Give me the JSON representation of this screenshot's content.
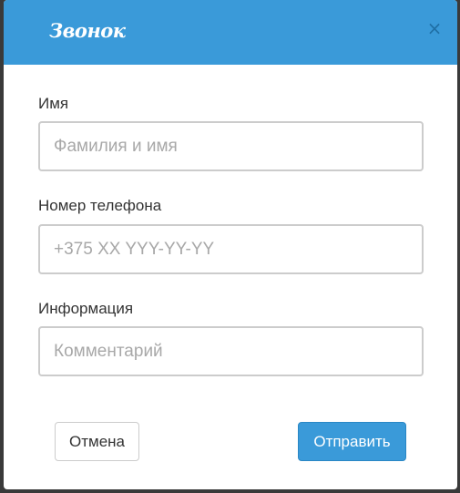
{
  "dialog": {
    "title": "Звонок",
    "close_symbol": "×"
  },
  "fields": {
    "name": {
      "label": "Имя",
      "value": "",
      "placeholder": "Фамилия и имя"
    },
    "phone": {
      "label": "Номер телефона",
      "value": "",
      "placeholder": "+375 XX YYY-YY-YY"
    },
    "info": {
      "label": "Информация",
      "value": "",
      "placeholder": "Комментарий"
    }
  },
  "buttons": {
    "cancel_label": "Отмена",
    "submit_label": "Отправить"
  },
  "colors": {
    "accent": "#3a9ad9",
    "close_icon": "#1f6fa5",
    "input_border": "#cccccc",
    "placeholder": "#a8a8a8",
    "backdrop": "#3a3a3a"
  },
  "icons": {
    "close": "close-icon"
  }
}
